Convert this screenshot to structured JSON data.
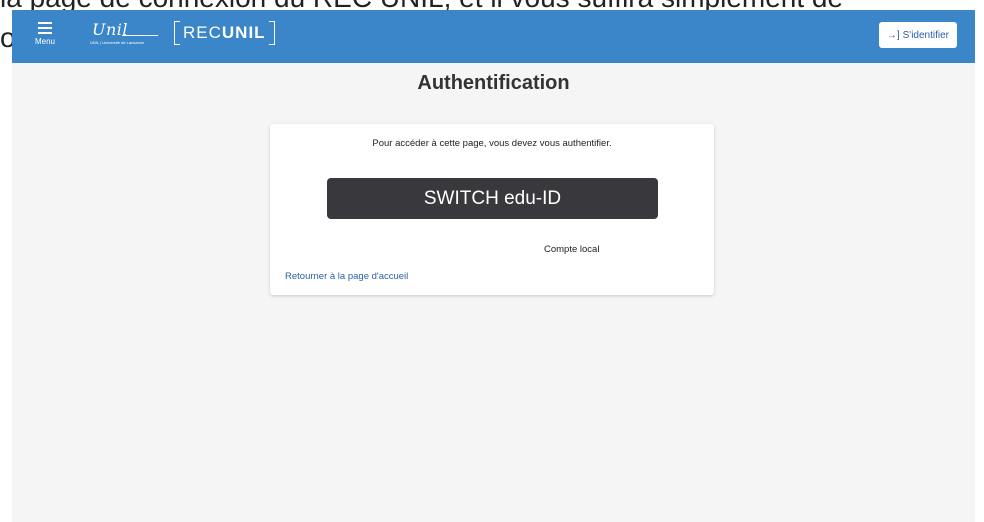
{
  "background_doc": {
    "line1_prefix": "la ",
    "line1_struck": "page de connexion du REC UNIL",
    "line1_suffix": ", et il vous suffira simplement de",
    "line2": "os"
  },
  "header": {
    "menu_label": "Menu",
    "unil_logo_text": "Unil",
    "unil_logo_sub": "UNIL | Université de Lausanne",
    "rec_logo_thin": "REC",
    "rec_logo_bold": "UNIL",
    "login_label": "S'identifier",
    "background_color": "#3a86c8"
  },
  "main": {
    "title": "Authentification",
    "card": {
      "message": "Pour accéder à cette page, vous devez vous authentifier.",
      "switch_button_label": "SWITCH edu-ID",
      "local_account_label": "Compte local",
      "home_link_label": "Retourner à la page d'accueil"
    }
  },
  "colors": {
    "accent": "#3a86c8",
    "link": "#2b5ea8",
    "switch_button": "#39383d"
  }
}
